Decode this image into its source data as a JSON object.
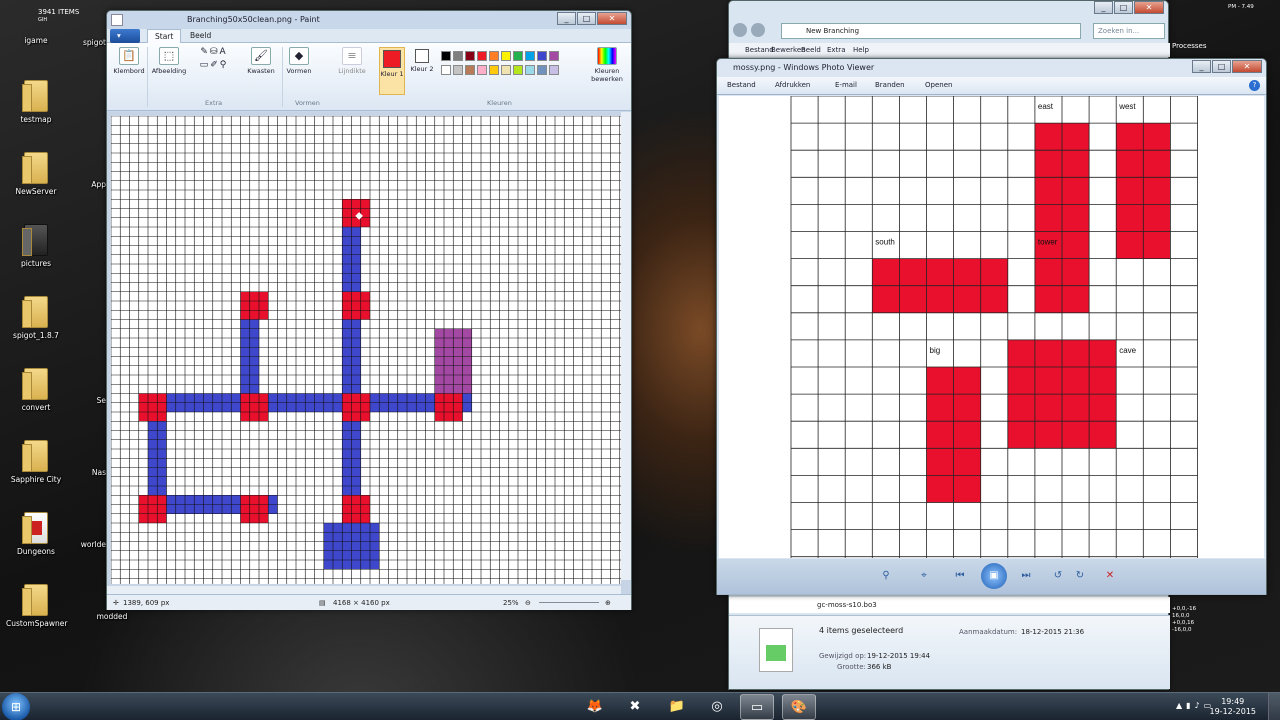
{
  "desktop": {
    "icons": [
      {
        "label": "igame"
      },
      {
        "label": "testmap"
      },
      {
        "label": "NewServer"
      },
      {
        "label": "pictures"
      },
      {
        "label": "spigot_1.8.7"
      },
      {
        "label": "convert"
      },
      {
        "label": "Sapphire City"
      },
      {
        "label": "Dungeons"
      },
      {
        "label": "CustomSpawner"
      },
      {
        "label": "modded"
      }
    ],
    "icons_col2": [
      {
        "label": "spigot"
      },
      {
        "label": "App"
      },
      {
        "label": "Se"
      },
      {
        "label": "Nas"
      },
      {
        "label": "worlde"
      }
    ],
    "partial_top": {
      "title": "3941 ITEMS",
      "sub": "GIH"
    },
    "right_label": "Processes",
    "right_numbers": [
      "+0,0,-16",
      "16,0,0",
      "+0,0,16",
      "-16,0,0"
    ],
    "top_text": "Klembord",
    "right_time_small": "PM - 7.49"
  },
  "paint": {
    "title": "Branching50x50clean.png - Paint",
    "tabs": {
      "file": "▾",
      "start": "Start",
      "view": "Beeld"
    },
    "tools": {
      "clipboard": "Klembord",
      "image": "Afbeelding",
      "brushes": "Kwasten",
      "shapes": "Vormen",
      "lines": "Lijndikte",
      "color1": "Kleur 1",
      "color2": "Kleur 2",
      "edit_colors": "Kleuren bewerken"
    },
    "groups": {
      "extra": "Extra",
      "shapes": "Vormen",
      "colors": "Kleuren"
    },
    "palette": [
      "#000000",
      "#7f7f7f",
      "#880015",
      "#ed1c24",
      "#ff7f27",
      "#fff200",
      "#22b14c",
      "#00a2e8",
      "#3f48cc",
      "#a349a4",
      "#ffffff",
      "#c3c3c3",
      "#b97a57",
      "#ffaec9",
      "#ffc90e",
      "#efe4b0",
      "#b5e61d",
      "#99d9ea",
      "#7092be",
      "#c8bfe7"
    ],
    "colors": {
      "primary": "#ed1c24",
      "blue": "#3f48cc",
      "red": "#e8102c",
      "purple": "#a349a4"
    },
    "status": {
      "cursor": "1389, 609 px",
      "size": "4168 × 4160 px",
      "zoom": "25%"
    }
  },
  "explorer": {
    "address": "New Branching",
    "search": "Zoeken in...",
    "menu": [
      "Bestand",
      "Bewerken",
      "Beeld",
      "Extra",
      "Help"
    ],
    "file_item": "gc-moss-s10.bo3",
    "details": {
      "selected": "4 items geselecteerd",
      "created_label": "Aanmaakdatum:",
      "created": "18-12-2015 21:36",
      "modified_label": "Gewijzigd op:",
      "modified": "19-12-2015 19:44",
      "size_label": "Grootte:",
      "size": "366 kB"
    }
  },
  "photoviewer": {
    "title": "mossy.png - Windows Photo Viewer",
    "menu": [
      "Bestand",
      "Afdrukken",
      "E-mail",
      "Branden",
      "Openen"
    ],
    "labels": {
      "east": "east",
      "west": "west",
      "south": "south",
      "tower": "tower",
      "big": "big",
      "cave": "cave"
    }
  },
  "taskbar": {
    "time": "19:49",
    "date": "19-12-2015"
  }
}
